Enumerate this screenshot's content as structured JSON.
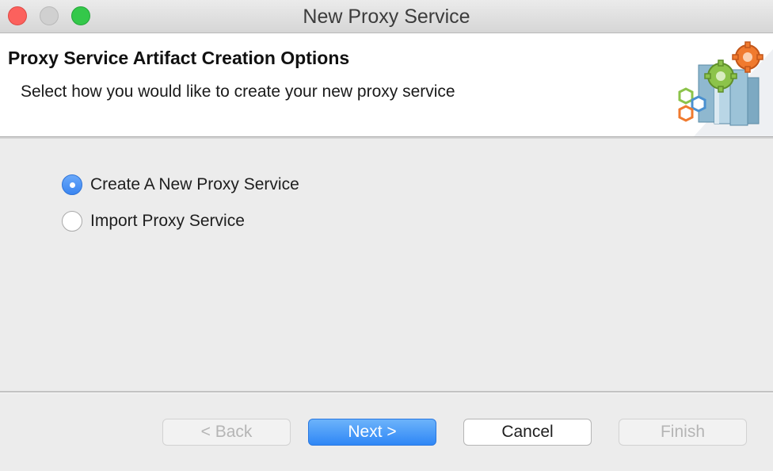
{
  "window": {
    "title": "New Proxy Service"
  },
  "banner": {
    "title": "Proxy Service Artifact Creation Options",
    "description": "Select how you would like to create your new proxy service",
    "graphic_icon": "gears-servers-icon"
  },
  "options": [
    {
      "label": "Create A New Proxy Service",
      "selected": true
    },
    {
      "label": "Import Proxy Service",
      "selected": false
    }
  ],
  "buttons": {
    "back": {
      "label": "< Back",
      "enabled": false
    },
    "next": {
      "label": "Next >",
      "enabled": true,
      "default": true
    },
    "cancel": {
      "label": "Cancel",
      "enabled": true
    },
    "finish": {
      "label": "Finish",
      "enabled": false
    }
  },
  "colors": {
    "accent": "#3a85f0",
    "close": "#fc615d",
    "maximize": "#34c84a"
  }
}
